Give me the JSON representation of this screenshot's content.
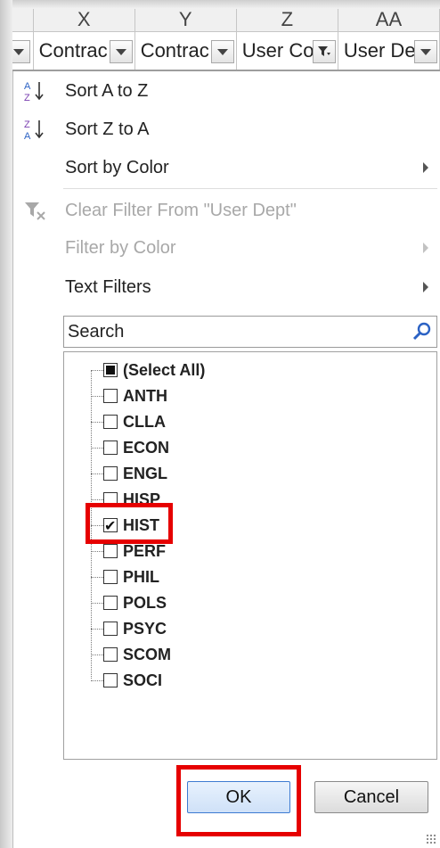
{
  "columns": {
    "letters": [
      "X",
      "Y",
      "Z",
      "AA"
    ],
    "headers": [
      "Contrac",
      "Contrac",
      "User Co",
      "User De"
    ]
  },
  "menu": {
    "sort_a_to_z": "Sort A to Z",
    "sort_z_to_a": "Sort Z to A",
    "sort_by_color": "Sort by Color",
    "clear_filter": "Clear Filter From \"User Dept\"",
    "filter_by_color": "Filter by Color",
    "text_filters": "Text Filters"
  },
  "search": {
    "placeholder": "Search"
  },
  "list": {
    "items": [
      {
        "label": "(Select All)",
        "state": "partial"
      },
      {
        "label": "ANTH",
        "state": "unchecked"
      },
      {
        "label": "CLLA",
        "state": "unchecked"
      },
      {
        "label": "ECON",
        "state": "unchecked"
      },
      {
        "label": "ENGL",
        "state": "unchecked"
      },
      {
        "label": "HISP",
        "state": "unchecked"
      },
      {
        "label": "HIST",
        "state": "checked"
      },
      {
        "label": "PERF",
        "state": "unchecked"
      },
      {
        "label": "PHIL",
        "state": "unchecked"
      },
      {
        "label": "POLS",
        "state": "unchecked"
      },
      {
        "label": "PSYC",
        "state": "unchecked"
      },
      {
        "label": "SCOM",
        "state": "unchecked"
      },
      {
        "label": "SOCI",
        "state": "unchecked"
      }
    ]
  },
  "buttons": {
    "ok": "OK",
    "cancel": "Cancel"
  },
  "colors": {
    "highlight": "#e60000",
    "sort_icon_blue": "#2b62c4",
    "sort_icon_purple": "#7a3fb0"
  }
}
